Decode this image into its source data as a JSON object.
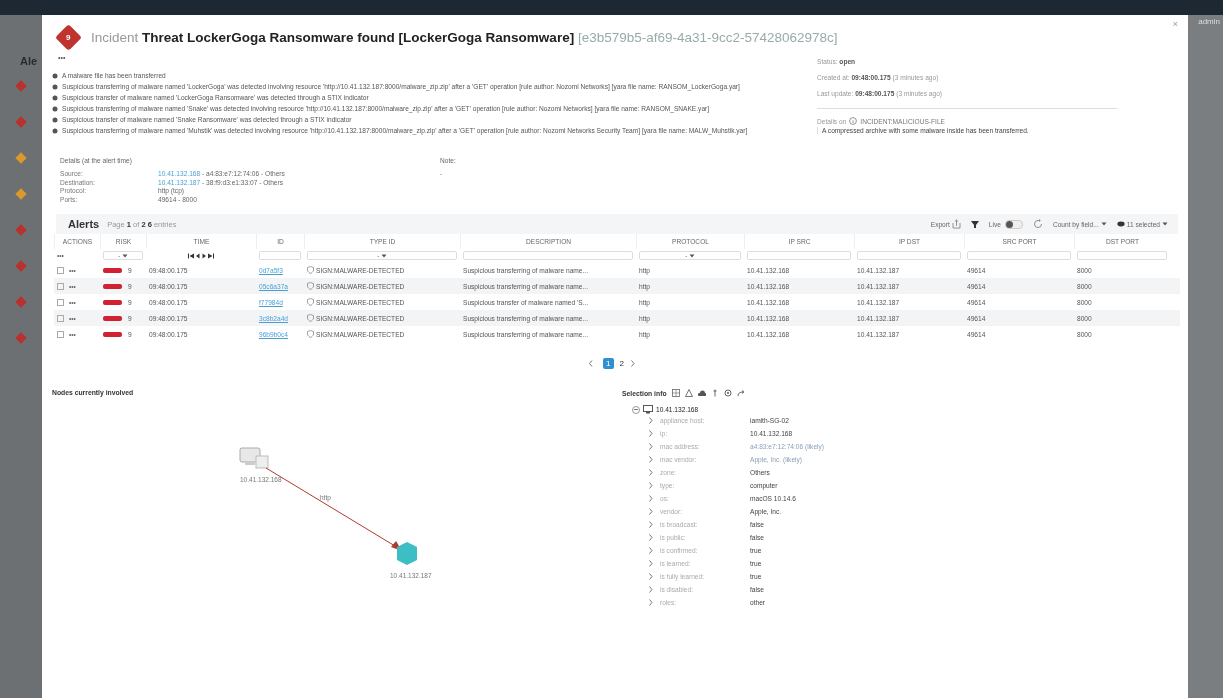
{
  "background": {
    "page_title": "Ale",
    "user": "admin",
    "badges": [
      {
        "color": "#b8312f"
      },
      {
        "color": "#b8312f"
      },
      {
        "color": "#d99a2b"
      },
      {
        "color": "#d99a2b"
      },
      {
        "color": "#b8312f"
      },
      {
        "color": "#b8312f"
      },
      {
        "color": "#b8312f"
      },
      {
        "color": "#b8312f"
      }
    ]
  },
  "incident": {
    "risk": "9",
    "prefix": "Incident",
    "title": "Threat LockerGoga Ransomware found [LockerGoga Ransomware]",
    "id": "[e3b579b5-af69-4a31-9cc2-57428062978c]",
    "close": "×",
    "more": "•••"
  },
  "summary": [
    "A malware file has been transferred",
    "Suspicious transferring of malware named 'LockerGoga' was detected involving resource 'http://10.41.132.187:8000/malware_zip.zip' after a 'GET' operation [rule author: Nozomi Networks] [yara file name: RANSOM_LockerGoga.yar]",
    "Suspicious transfer of malware named 'LockerGoga Ransomware' was detected through a STIX indicator",
    "Suspicious transferring of malware named 'Snake' was detected involving resource 'http://10.41.132.187:8000/malware_zip.zip' after a 'GET' operation [rule author: Nozomi Networks] [yara file name: RANSOM_SNAKE.yar]",
    "Suspicious transfer of malware named 'Snake Ransomware' was detected through a STIX indicator",
    "Suspicious transferring of malware named 'Muhstik' was detected involving resource 'http://10.41.132.187:8000/malware_zip.zip' after a 'GET' operation [rule author: Nozomi Networks Security Team] [yara file name: MALW_Muhstik.yar]"
  ],
  "status": [
    {
      "label": "Status:",
      "value": "open"
    },
    {
      "label": "Created at:",
      "value": "09:48:00.175",
      "note": "(3 minutes ago)"
    },
    {
      "label": "Last update:",
      "value": "09:48:00.175",
      "note": "(3 minutes ago)"
    }
  ],
  "details_on": {
    "label": "Details on",
    "type": "INCIDENT:MALICIOUS-FILE",
    "description": "A compressed archive with some malware inside has been transferred."
  },
  "details": {
    "title": "Details (at the alert time)",
    "rows": [
      {
        "label": "Source:",
        "link": "10.41.132.168",
        "rest": " - a4:83:e7:12:74:06 - Others"
      },
      {
        "label": "Destination:",
        "link": "10.41.132.187",
        "rest": " - 38:f9:d3:e1:33:07 - Others"
      },
      {
        "label": "Protocol:",
        "link": "",
        "rest": "http (tcp)"
      },
      {
        "label": "Ports:",
        "link": "",
        "rest": "49614 - 8000"
      }
    ],
    "note_title": "Note:",
    "note": "-"
  },
  "alerts": {
    "title": "Alerts",
    "page_prefix": "Page",
    "page": "1",
    "page_of": "of",
    "pages": "2",
    "count": "6",
    "count_suffix": "entries",
    "export": "Export",
    "live": "Live",
    "live_on": false,
    "count_by": "Count by field...",
    "selected": "11 selected",
    "columns": [
      "ACTIONS",
      "RISK",
      "TIME",
      "ID",
      "TYPE ID",
      "DESCRIPTION",
      "PROTOCOL",
      "IP SRC",
      "IP DST",
      "SRC PORT",
      "DST PORT"
    ],
    "filters": [
      {
        "kind": "menu",
        "text": "•••"
      },
      {
        "kind": "dropdown",
        "value": "-"
      },
      {
        "kind": "nav"
      },
      {
        "kind": "field"
      },
      {
        "kind": "dropdown",
        "value": "-"
      },
      {
        "kind": "field"
      },
      {
        "kind": "dropdown",
        "value": "-"
      },
      {
        "kind": "field"
      },
      {
        "kind": "field"
      },
      {
        "kind": "field"
      },
      {
        "kind": "field"
      }
    ],
    "rows": [
      {
        "checked": false,
        "actions": "•••",
        "risk": "9",
        "time": "09:48:00.175",
        "id": "0d7a5f3",
        "type": "SIGN:MALWARE-DETECTED",
        "description": "Suspicious transferring of malware name...",
        "protocol": "http",
        "ip_src": "10.41.132.168",
        "ip_dst": "10.41.132.187",
        "src_port": "49614",
        "dst_port": "8000"
      },
      {
        "checked": false,
        "actions": "•••",
        "risk": "9",
        "time": "09:48:00.175",
        "id": "05c6a37a",
        "type": "SIGN:MALWARE-DETECTED",
        "description": "Suspicious transferring of malware name...",
        "protocol": "http",
        "ip_src": "10.41.132.168",
        "ip_dst": "10.41.132.187",
        "src_port": "49614",
        "dst_port": "8000"
      },
      {
        "checked": false,
        "actions": "•••",
        "risk": "9",
        "time": "09:48:00.175",
        "id": "f77984d",
        "type": "SIGN:MALWARE-DETECTED",
        "description": "Suspicious transfer of malware named 'S...",
        "protocol": "http",
        "ip_src": "10.41.132.168",
        "ip_dst": "10.41.132.187",
        "src_port": "49614",
        "dst_port": "8000"
      },
      {
        "checked": false,
        "actions": "•••",
        "risk": "9",
        "time": "09:48:00.175",
        "id": "3c8b2a4d",
        "type": "SIGN:MALWARE-DETECTED",
        "description": "Suspicious transferring of malware name...",
        "protocol": "http",
        "ip_src": "10.41.132.168",
        "ip_dst": "10.41.132.187",
        "src_port": "49614",
        "dst_port": "8000"
      },
      {
        "checked": false,
        "actions": "•••",
        "risk": "9",
        "time": "09:48:00.175",
        "id": "96b9b0c4",
        "type": "SIGN:MALWARE-DETECTED",
        "description": "Suspicious transferring of malware name...",
        "protocol": "http",
        "ip_src": "10.41.132.168",
        "ip_dst": "10.41.132.187",
        "src_port": "49614",
        "dst_port": "8000"
      }
    ],
    "pagination": [
      {
        "label": "1",
        "selected": true
      },
      {
        "label": "2",
        "selected": false
      }
    ]
  },
  "nodes_panel": {
    "title": "Nodes currently involved",
    "source": "10.41.132.168",
    "target": "10.41.132.187",
    "edge": "http"
  },
  "selection": {
    "title": "Selection info",
    "node": "10.41.132.168",
    "expanded": true,
    "properties": [
      {
        "key": "appliance host:",
        "value": "iamith-SG-02",
        "muted": false
      },
      {
        "key": "ip:",
        "value": "10.41.132.168",
        "muted": false
      },
      {
        "key": "mac address:",
        "value": "a4:83:e7:12:74:06 (likely)",
        "muted": true
      },
      {
        "key": "mac vendor:",
        "value": "Apple, Inc. (likely)",
        "muted": true
      },
      {
        "key": "zone:",
        "value": "Others",
        "muted": false
      },
      {
        "key": "type:",
        "value": "computer",
        "muted": false
      },
      {
        "key": "os:",
        "value": "macOS 10.14.6",
        "muted": false
      },
      {
        "key": "vendor:",
        "value": "Apple, Inc.",
        "muted": false
      },
      {
        "key": "is broadcast:",
        "value": "false",
        "muted": false
      },
      {
        "key": "is public:",
        "value": "false",
        "muted": false
      },
      {
        "key": "is confirmed:",
        "value": "true",
        "muted": false
      },
      {
        "key": "is learned:",
        "value": "true",
        "muted": false
      },
      {
        "key": "is fully learned:",
        "value": "true",
        "muted": false
      },
      {
        "key": "is disabled:",
        "value": "false",
        "muted": false
      },
      {
        "key": "roles:",
        "value": "other",
        "muted": false
      }
    ]
  }
}
